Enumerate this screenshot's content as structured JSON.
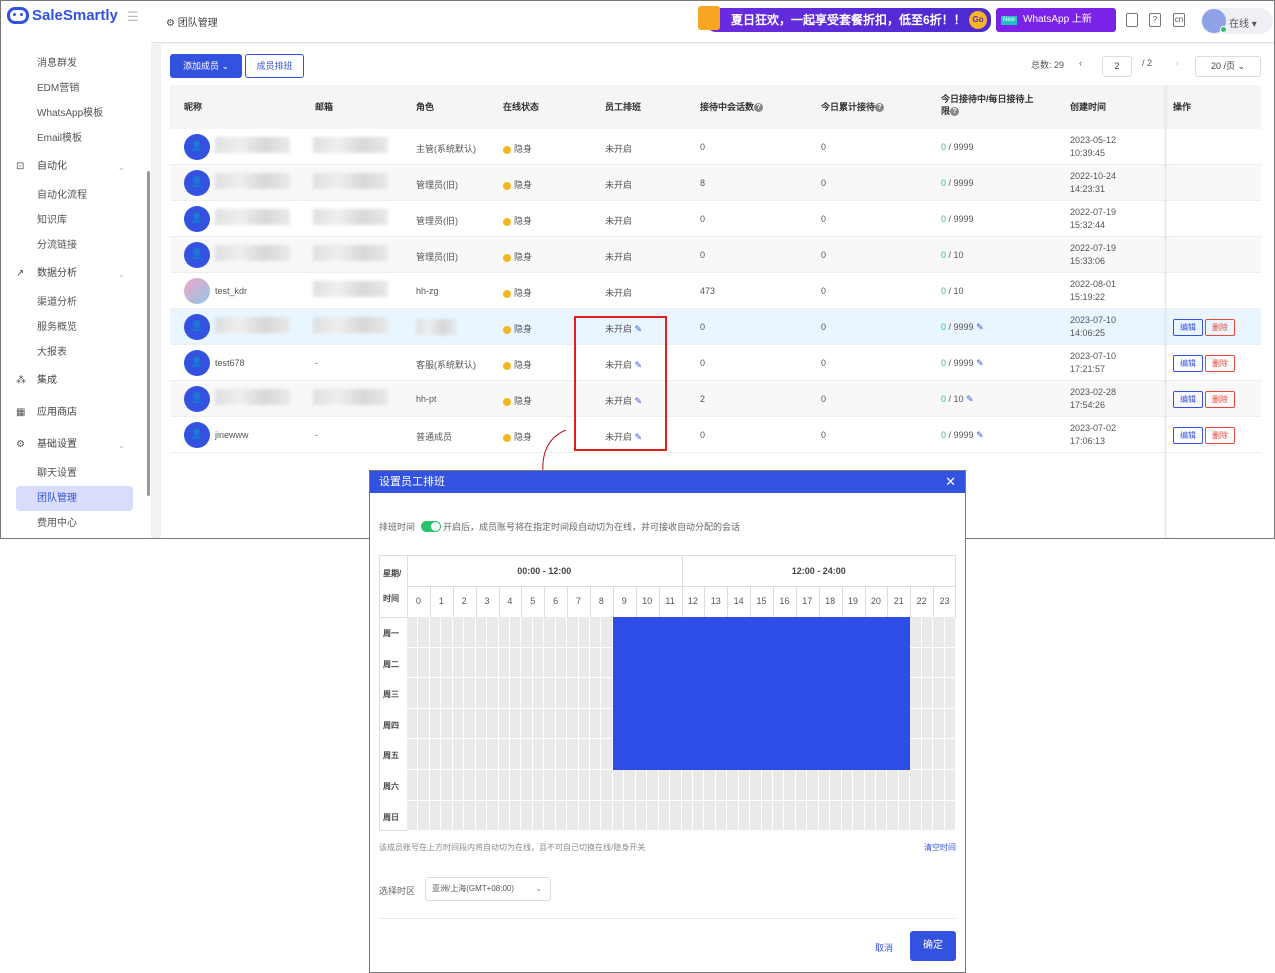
{
  "brand": "SaleSmartly",
  "colors": {
    "primary": "#3452e0",
    "success": "#2bc46a",
    "danger": "#e8483a",
    "warning": "#f5b623"
  },
  "sidebar": {
    "items": [
      {
        "label": "消息群发",
        "type": "item"
      },
      {
        "label": "EDM营销",
        "type": "item"
      },
      {
        "label": "WhatsApp模板",
        "type": "item"
      },
      {
        "label": "Email模板",
        "type": "item"
      },
      {
        "label": "自动化",
        "type": "group",
        "icon": "robot-icon"
      },
      {
        "label": "自动化流程",
        "type": "item"
      },
      {
        "label": "知识库",
        "type": "item"
      },
      {
        "label": "分流链接",
        "type": "item"
      },
      {
        "label": "数据分析",
        "type": "group",
        "icon": "chart-icon"
      },
      {
        "label": "渠道分析",
        "type": "item"
      },
      {
        "label": "服务概览",
        "type": "item"
      },
      {
        "label": "大报表",
        "type": "item"
      },
      {
        "label": "集成",
        "type": "group",
        "icon": "integration-icon"
      },
      {
        "label": "应用商店",
        "type": "group",
        "icon": "apps-icon"
      },
      {
        "label": "基础设置",
        "type": "group",
        "icon": "gear-icon"
      },
      {
        "label": "聊天设置",
        "type": "item"
      },
      {
        "label": "团队管理",
        "type": "item",
        "active": true
      },
      {
        "label": "费用中心",
        "type": "item"
      }
    ]
  },
  "header": {
    "breadcrumb": "团队管理",
    "promo": "夏日狂欢，一起享受套餐折扣，低至6折！！",
    "promo_go": "Go",
    "promo2_badge": "New",
    "promo2": "WhatsApp 上新",
    "status": "在线"
  },
  "toolbar": {
    "add_member": "添加成员",
    "schedule": "成员排班",
    "total_label": "总数: 29",
    "page": "2",
    "page_total": "/ 2",
    "page_size": "20 /页"
  },
  "table": {
    "columns": [
      "昵称",
      "邮箱",
      "角色",
      "在线状态",
      "员工排班",
      "接待中会话数",
      "今日累计接待",
      "今日接待中/每日接待上限",
      "创建时间",
      "操作"
    ],
    "rows": [
      {
        "name": "",
        "email": "",
        "role": "主管(系统默认)",
        "status": "隐身",
        "shift": "未开启",
        "sessions": "0",
        "today": "0",
        "cur": "0",
        "limit": "/ 9999",
        "date": "2023-05-12",
        "time": "10:39:45",
        "editable": false
      },
      {
        "name": "",
        "email": "",
        "role": "管理员(旧)",
        "status": "隐身",
        "shift": "未开启",
        "sessions": "8",
        "today": "0",
        "cur": "0",
        "limit": "/ 9999",
        "date": "2022-10-24",
        "time": "14:23:31",
        "editable": false
      },
      {
        "name": "",
        "email": "",
        "role": "管理员(旧)",
        "status": "隐身",
        "shift": "未开启",
        "sessions": "0",
        "today": "0",
        "cur": "0",
        "limit": "/ 9999",
        "date": "2022-07-19",
        "time": "15:32:44",
        "editable": false
      },
      {
        "name": "",
        "email": "",
        "role": "管理员(旧)",
        "status": "隐身",
        "shift": "未开启",
        "sessions": "0",
        "today": "0",
        "cur": "0",
        "limit": "/ 10",
        "date": "2022-07-19",
        "time": "15:33:06",
        "editable": false
      },
      {
        "name": "test_kdr",
        "email": "",
        "role": "hh-zg",
        "status": "隐身",
        "shift": "未开启",
        "sessions": "473",
        "today": "0",
        "cur": "0",
        "limit": "/ 10",
        "date": "2022-08-01",
        "time": "15:19:22",
        "editable": false
      },
      {
        "name": "",
        "email": "",
        "role": "",
        "status": "隐身",
        "shift": "未开启",
        "sessions": "0",
        "today": "0",
        "cur": "0",
        "limit": "/ 9999",
        "date": "2023-07-10",
        "time": "14:06:25",
        "editable": true
      },
      {
        "name": "test678",
        "email": "-",
        "role": "客服(系统默认)",
        "status": "隐身",
        "shift": "未开启",
        "sessions": "0",
        "today": "0",
        "cur": "0",
        "limit": "/ 9999",
        "date": "2023-07-10",
        "time": "17:21:57",
        "editable": true
      },
      {
        "name": "",
        "email": "",
        "role": "hh-pt",
        "status": "隐身",
        "shift": "未开启",
        "sessions": "2",
        "today": "0",
        "cur": "0",
        "limit": "/ 10",
        "date": "2023-02-28",
        "time": "17:54:26",
        "editable": true
      },
      {
        "name": "jinewww",
        "email": "-",
        "role": "普通成员",
        "status": "隐身",
        "shift": "未开启",
        "sessions": "0",
        "today": "0",
        "cur": "0",
        "limit": "/ 9999",
        "date": "2023-07-02",
        "time": "17:06:13",
        "editable": true
      }
    ],
    "edit_label": "编辑",
    "delete_label": "删除"
  },
  "modal": {
    "title": "设置员工排班",
    "toggle_label": "排班时间",
    "toggle_on": true,
    "toggle_desc": "开启后，成员账号将在指定时间段自动切为在线，并可接收自动分配的会话",
    "corner_top": "星期/",
    "corner_bottom": "时间",
    "range_am": "00:00 - 12:00",
    "range_pm": "12:00 - 24:00",
    "hours": [
      "0",
      "1",
      "2",
      "3",
      "4",
      "5",
      "6",
      "7",
      "8",
      "9",
      "10",
      "11",
      "12",
      "13",
      "14",
      "15",
      "16",
      "17",
      "18",
      "19",
      "20",
      "21",
      "22",
      "23"
    ],
    "days": [
      "周一",
      "周二",
      "周三",
      "周四",
      "周五",
      "周六",
      "周日"
    ],
    "schedule": [
      [
        9,
        22
      ],
      [
        9,
        22
      ],
      [
        9,
        22
      ],
      [
        9,
        22
      ],
      [
        9,
        22
      ],
      null,
      null
    ],
    "note": "该成员账号在上方时间段内将自动切为在线，且不可自己切换在线/隐身开关",
    "clear": "清空时间",
    "tz_label": "选择时区",
    "tz_value": "亚洲/上海(GMT+08:00)",
    "cancel": "取消",
    "confirm": "确定"
  }
}
